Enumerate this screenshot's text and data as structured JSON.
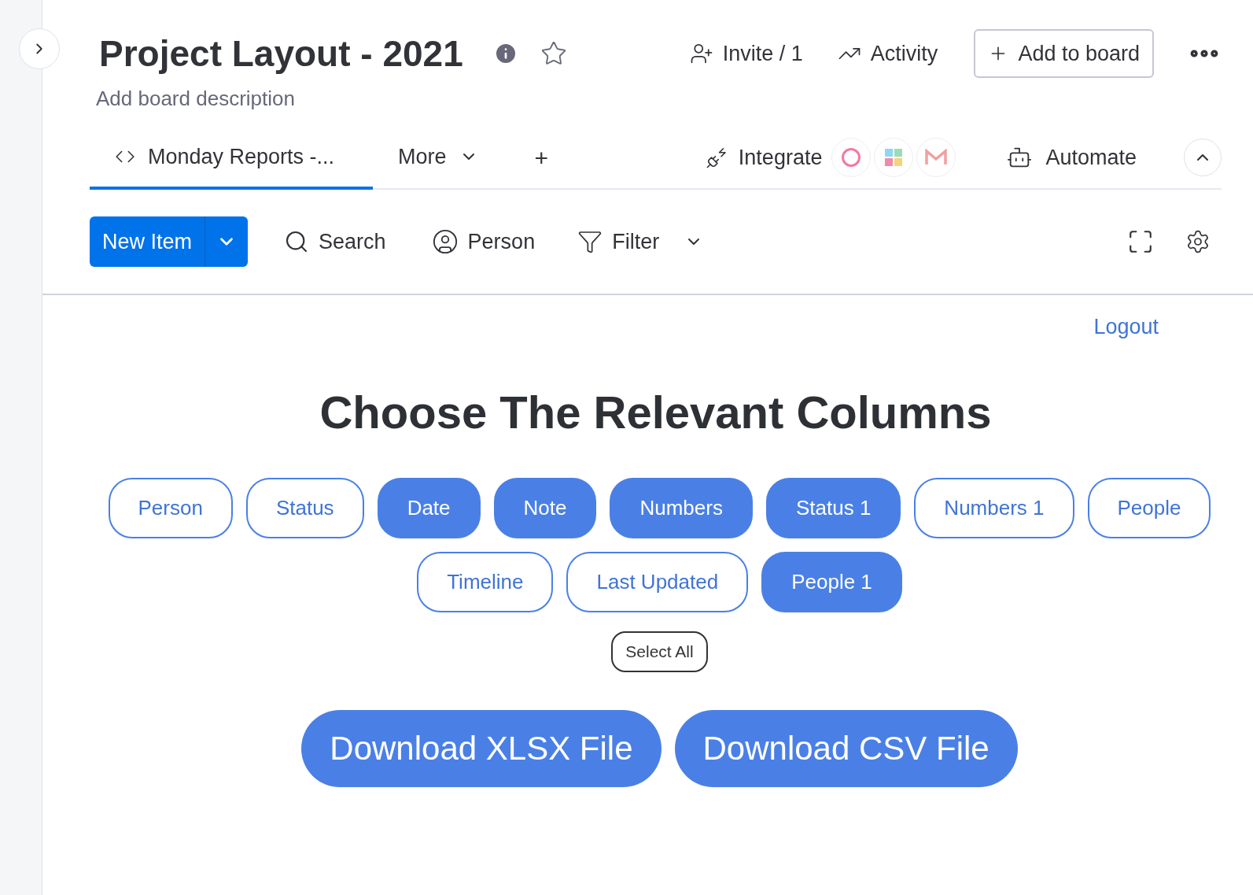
{
  "board": {
    "title": "Project Layout - 2021",
    "description": "Add board description"
  },
  "header_actions": {
    "invite": "Invite / 1",
    "activity": "Activity",
    "add_to_board": "Add to board"
  },
  "tabs": [
    {
      "label": "Monday Reports -...",
      "selected": true
    },
    {
      "label": "More",
      "selected": false
    }
  ],
  "add_tab": "+",
  "integrate": "Integrate",
  "automate": "Automate",
  "toolbar": {
    "new_item": "New Item",
    "search": "Search",
    "person": "Person",
    "filter": "Filter"
  },
  "logout": "Logout",
  "heading": "Choose The Relevant Columns",
  "columns": [
    {
      "label": "Person",
      "selected": false
    },
    {
      "label": "Status",
      "selected": false
    },
    {
      "label": "Date",
      "selected": true
    },
    {
      "label": "Note",
      "selected": true
    },
    {
      "label": "Numbers",
      "selected": true
    },
    {
      "label": "Status 1",
      "selected": true
    },
    {
      "label": "Numbers 1",
      "selected": false
    },
    {
      "label": "People",
      "selected": false
    },
    {
      "label": "Timeline",
      "selected": false
    },
    {
      "label": "Last Updated",
      "selected": false
    },
    {
      "label": "People 1",
      "selected": true
    }
  ],
  "select_all": "Select All",
  "downloads": [
    "Download XLSX File",
    "Download CSV File"
  ]
}
